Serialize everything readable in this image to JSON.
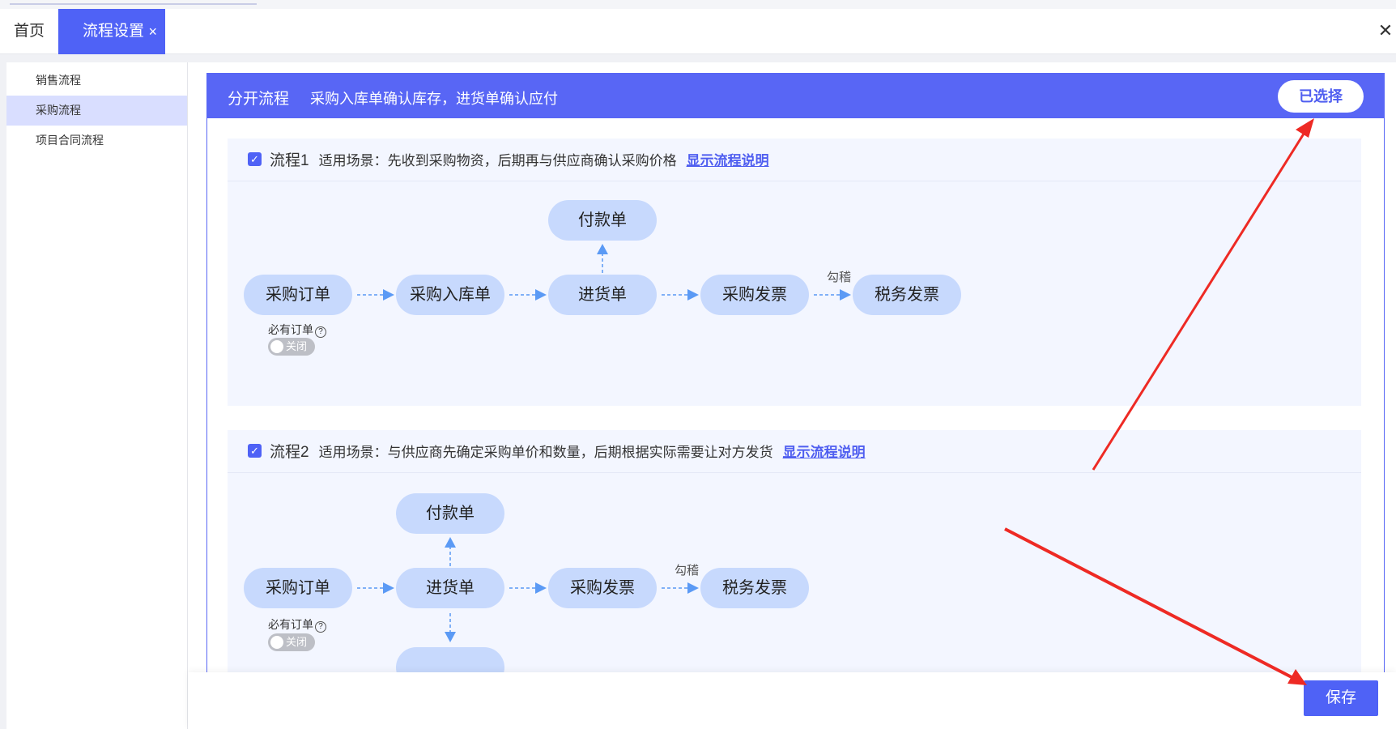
{
  "tabs": {
    "home": "首页",
    "active": "流程设置",
    "close_glyph": "×",
    "window_close_glyph": "✕"
  },
  "sidebar": {
    "items": [
      {
        "label": "销售流程"
      },
      {
        "label": "采购流程"
      },
      {
        "label": "项目合同流程"
      }
    ]
  },
  "panel": {
    "title": "分开流程",
    "description": "采购入库单确认库存，进货单确认应付",
    "selected_label": "已选择"
  },
  "flows": [
    {
      "name": "流程1",
      "scenario": "适用场景：先收到采购物资，后期再与供应商确认采购价格",
      "link": "显示流程说明",
      "nodes": {
        "payment": "付款单",
        "order": "采购订单",
        "inbound": "采购入库单",
        "receipt": "进货单",
        "invoice": "采购发票",
        "tax": "税务发票"
      },
      "gouji": "勾稽",
      "must_order": "必有订单",
      "switch_label": "关闭"
    },
    {
      "name": "流程2",
      "scenario": "适用场景：与供应商先确定采购单价和数量，后期根据实际需要让对方发货",
      "link": "显示流程说明",
      "nodes": {
        "payment": "付款单",
        "order": "采购订单",
        "receipt": "进货单",
        "invoice": "采购发票",
        "tax": "税务发票"
      },
      "gouji": "勾稽",
      "must_order": "必有订单",
      "switch_label": "关闭"
    }
  ],
  "footer": {
    "save_label": "保存"
  },
  "colors": {
    "accent": "#4f62f6",
    "node": "#c7d9fd",
    "annotation": "#ee2a24"
  }
}
